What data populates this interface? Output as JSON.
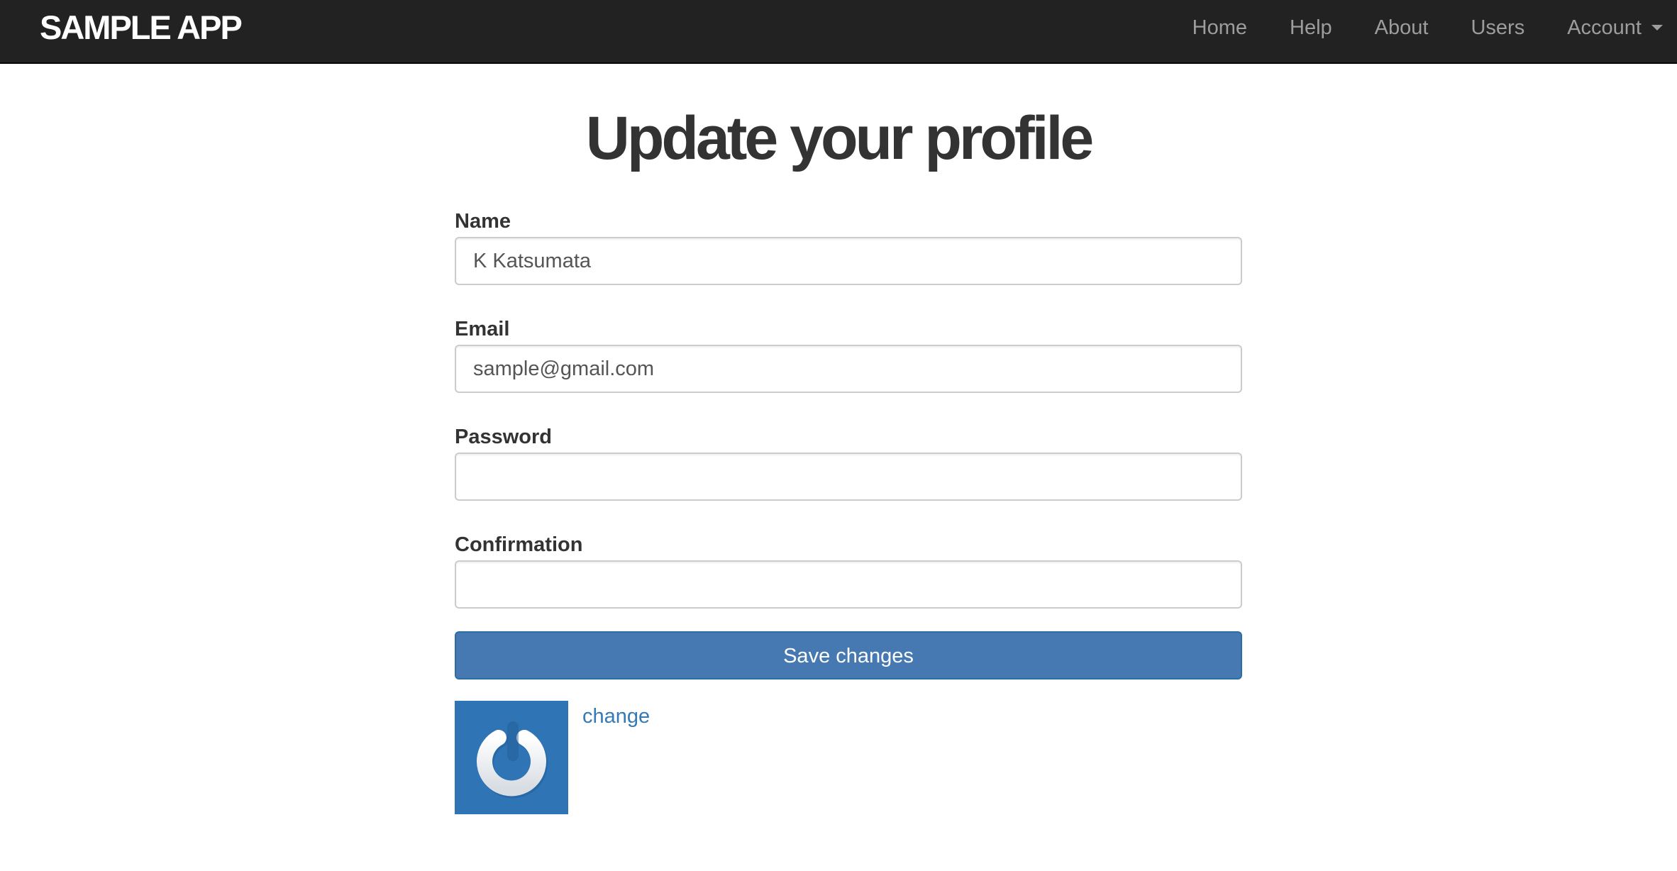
{
  "navbar": {
    "brand": "SAMPLE APP",
    "links": {
      "home": "Home",
      "help": "Help",
      "about": "About",
      "users": "Users",
      "account": "Account"
    }
  },
  "page": {
    "title": "Update your profile"
  },
  "form": {
    "name_label": "Name",
    "name_value": "K Katsumata",
    "email_label": "Email",
    "email_value": "sample@gmail.com",
    "password_label": "Password",
    "password_value": "",
    "confirmation_label": "Confirmation",
    "confirmation_value": "",
    "submit_label": "Save changes"
  },
  "gravatar": {
    "change_label": "change",
    "avatar_icon": "power-icon",
    "avatar_color": "#2f74b5"
  },
  "colors": {
    "navbar_bg": "#222222",
    "primary_button": "#4679b2",
    "link": "#337ab7"
  }
}
